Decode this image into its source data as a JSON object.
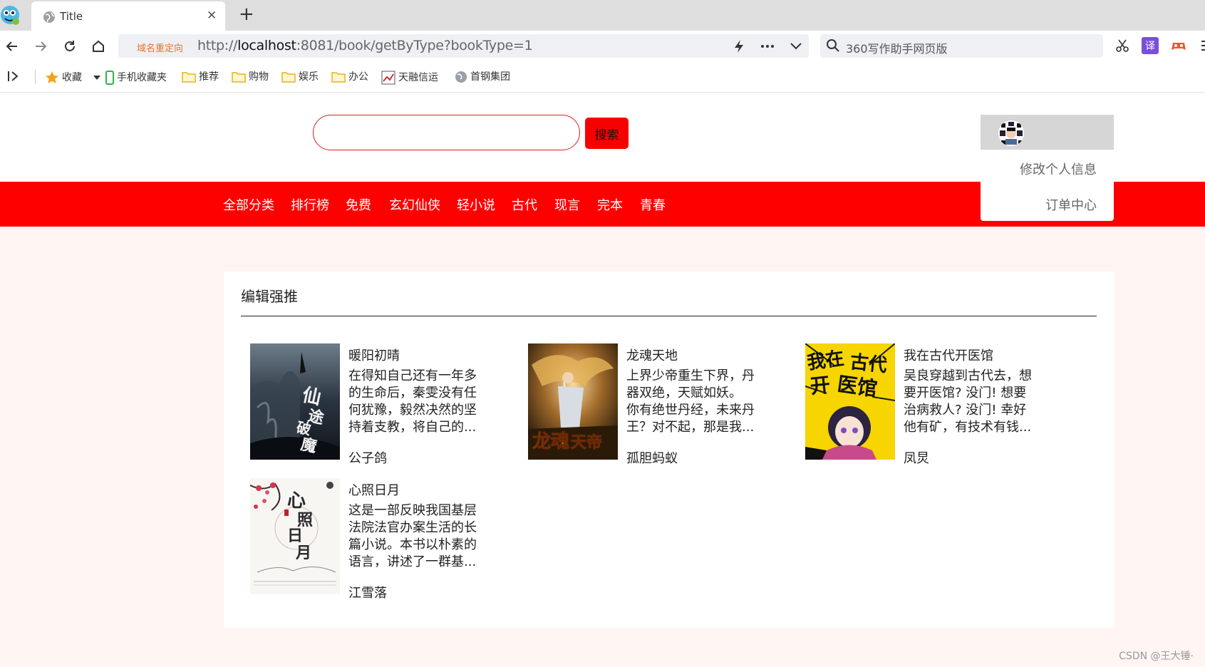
{
  "browser": {
    "tab_title": "Title",
    "redirect_label": "域名重定向",
    "url_prefix": "http://",
    "url_host": "localhost",
    "url_rest": ":8081/book/getByType?bookType=1",
    "search_placeholder": "360写作助手网页版",
    "ext_translate_label": "译"
  },
  "bookmarks": [
    {
      "label": "收藏",
      "icon": "star-icon"
    },
    {
      "label": "手机收藏夹",
      "icon": "phone-icon"
    },
    {
      "label": "推荐",
      "icon": "folder-icon"
    },
    {
      "label": "购物",
      "icon": "folder-icon"
    },
    {
      "label": "娱乐",
      "icon": "folder-icon"
    },
    {
      "label": "办公",
      "icon": "folder-icon"
    },
    {
      "label": "天融信运",
      "icon": "site-icon"
    },
    {
      "label": "首钢集团",
      "icon": "globe-icon"
    }
  ],
  "header": {
    "search_value": "",
    "search_button": "搜索"
  },
  "user_menu": {
    "items": [
      "修改个人信息",
      "订单中心"
    ]
  },
  "nav": {
    "items": [
      "全部分类",
      "排行榜",
      "免费",
      "玄幻仙侠",
      "轻小说",
      "古代",
      "现言",
      "完本",
      "青春"
    ]
  },
  "colors": {
    "brand_red": "#fe0000",
    "page_bg": "#fff5f3"
  },
  "section": {
    "title": "编辑强推",
    "books": [
      {
        "title": "暖阳初晴",
        "desc": "在得知自己还有一年多的生命后，秦雯没有任何犹豫，毅然决然的坚持着支教，将自己的...",
        "author": "公子鸽",
        "cover_text": "仙途破魔"
      },
      {
        "title": "龙魂天地",
        "desc": "上界少帝重生下界，丹器双绝，天赋如妖。 你有绝世丹经，未来丹王？对不起，那是我...",
        "author": "孤胆蚂蚁",
        "cover_text": "龙魂天帝"
      },
      {
        "title": "我在古代开医馆",
        "desc": "吴良穿越到古代去，想要开医馆? 没门! 想要治病救人? 没门! 幸好他有矿，有技术有钱...",
        "author": "凤炅",
        "cover_text": "我在古代开医馆"
      },
      {
        "title": "心照日月",
        "desc": "这是一部反映我国基层法院法官办案生活的长篇小说。本书以朴素的语言，讲述了一群基...",
        "author": "江雪落",
        "cover_text": "心照日月"
      }
    ]
  },
  "watermark": "CSDN @王大锤·"
}
